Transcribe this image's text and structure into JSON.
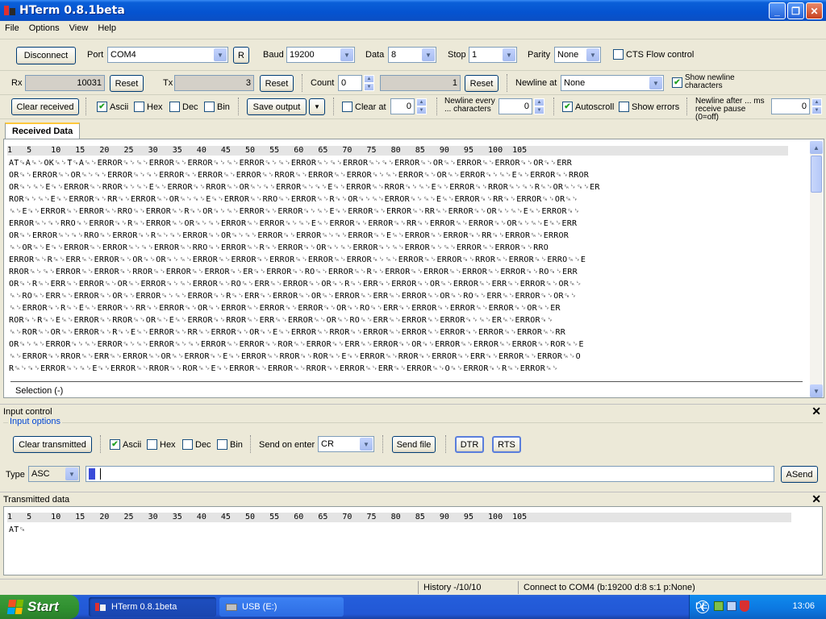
{
  "window": {
    "title": "HTerm 0.8.1beta"
  },
  "menu": [
    "File",
    "Options",
    "View",
    "Help"
  ],
  "connection": {
    "disconnect_label": "Disconnect",
    "port_label": "Port",
    "port_value": "COM4",
    "refresh_label": "R",
    "baud_label": "Baud",
    "baud_value": "19200",
    "data_label": "Data",
    "data_value": "8",
    "stop_label": "Stop",
    "stop_value": "1",
    "parity_label": "Parity",
    "parity_value": "None",
    "cts_label": "CTS Flow control",
    "cts_checked": false
  },
  "counters": {
    "rx_label": "Rx",
    "rx_value": "10031",
    "rx_reset": "Reset",
    "tx_label": "Tx",
    "tx_value": "3",
    "tx_reset": "Reset",
    "count_label": "Count",
    "count_value": "0",
    "count_total": "1",
    "count_reset": "Reset",
    "newline_label": "Newline at",
    "newline_value": "None",
    "show_newline_label": "Show newline characters"
  },
  "display": {
    "clear_received": "Clear received",
    "ascii": "Ascii",
    "hex": "Hex",
    "dec": "Dec",
    "bin": "Bin",
    "save_output": "Save output",
    "clear_at": "Clear at",
    "clear_at_value": "0",
    "newline_every": "Newline every ... characters",
    "newline_every_value": "0",
    "autoscroll": "Autoscroll",
    "show_errors": "Show errors",
    "newline_after": "Newline after ... ms receive pause (0=off)",
    "newline_after_value": "0"
  },
  "received": {
    "tab_label": "Received Data",
    "ruler": "1   5    10   15   20   25   30   35   40   45   50   55   60   65   70   75   80   85   90   95   100  105",
    "lines": [
      "AT␍A␍␊OK␍␊T␍A␍␊ERROR␍␊␍␊ERROR␍␊ERROR␍␊␍␊ERROR␍␊␍␊ERROR␍␊␍␊ERROR␍␊␍␊ERROR␍␊OR␍␊ERROR␍␊ERROR␍␊OR␍␊ERR",
      "OR␍␊ERROR␍␊OR␍␊␍␊ERROR␍␊␍␊ERROR␍␊ERROR␍␊ERROR␍␊RROR␍␊ERROR␍␊ERROR␍␊␍␊ERROR␍␊OR␍␊ERROR␍␊␍␊E␍␊ERROR␍␊RROR",
      "OR␍␊␍␊E␍␊ERROR␍␊RROR␍␊␍␊E␍␊ERROR␍␊RROR␍␊OR␍␊␍␊ERROR␍␊␍␊E␍␊ERROR␍␊RROR␍␊␍␊E␍␊ERROR␍␊RROR␍␊␍␊R␍␊OR␍␊␍␊ER",
      "ROR␍␊␍␊E␍␊ERROR␍␊RR␍␊ERROR␍␊OR␍␊␍␊E␍␊ERROR␍␊RRO␍␊ERROR␍␊R␍␊OR␍␊␍␊ERROR␍␊␍␊E␍␊ERROR␍␊RR␍␊ERROR␍␊OR␍␊",
      "␍␊E␍␊ERROR␍␊ERROR␍␊RRO␍␊ERROR␍␊R␍␊OR␍␊␍␊ERROR␍␊ERROR␍␊␍␊E␍␊ERROR␍␊ERROR␍␊RR␍␊ERROR␍␊OR␍␊␍␊E␍␊ERROR␍␊",
      "ERROR␍␊␍␊RRO␍␊ERROR␍␊R␍␊ERROR␍␊OR␍␊␍␊ERROR␍␊ERROR␍␊␍␊E␍␊ERROR␍␊ERROR␍␊RR␍␊ERROR␍␊ERROR␍␊OR␍␊␍␊E␍␊ERR",
      "OR␍␊ERROR␍␊␍␊RRO␍␊ERROR␍␊R␍␊␍␊ERROR␍␊OR␍␊␍␊ERROR␍␊ERROR␍␊␍␊ERROR␍␊E␍␊ERROR␍␊ERROR␍␊RR␍␊ERROR␍␊ERROR",
      "␍␊OR␍␊E␍␊ERROR␍␊ERROR␍␊␍␊ERROR␍␊RRO␍␊ERROR␍␊R␍␊ERROR␍␊OR␍␊␍␊ERROR␍␊␍␊ERROR␍␊␍␊ERROR␍␊ERROR␍␊RRO",
      "ERROR␍␊R␍␊ERR␍␊ERROR␍␊OR␍␊OR␍␊␍␊ERROR␍␊ERROR␍␊ERROR␍␊ERROR␍␊ERROR␍␊␍␊ERROR␍␊ERROR␍␊RROR␍␊ERROR␍␊ERRO␍␊E",
      "RROR␍␊␍␊ERROR␍␊ERROR␍␊RROR␍␊ERROR␍␊ERROR␍␊ER␍␊ERROR␍␊RO␍␊ERROR␍␊R␍␊ERROR␍␊ERROR␍␊ERROR␍␊ERROR␍␊RO␍␊ERR",
      "OR␍␊R␍␊ERR␍␊ERROR␍␊OR␍␊ERROR␍␊␍␊ERROR␍␊RO␍␊ERR␍␊ERROR␍␊OR␍␊R␍␊ERR␍␊ERROR␍␊OR␍␊ERROR␍␊ERR␍␊ERROR␍␊OR␍␊",
      "␍␊RO␍␊ERR␍␊ERROR␍␊OR␍␊ERROR␍␊␍␊ERROR␍␊R␍␊ERR␍␊ERROR␍␊OR␍␊ERROR␍␊ERR␍␊ERROR␍␊OR␍␊RO␍␊ERR␍␊ERROR␍␊OR␍␊",
      "␍␊ERROR␍␊R␍␊E␍␊ERROR␍␊RR␍␊ERROR␍␊OR␍␊ERROR␍␊ERROR␍␊ERROR␍␊OR␍␊RO␍␊ERR␍␊ERROR␍␊ERROR␍␊ERROR␍␊OR␍␊ER",
      "ROR␍␊R␍␊E␍␊ERROR␍␊RROR␍␊OR␍␊E␍␊ERROR␍␊RROR␍␊ERR␍␊ERROR␍␊OR␍␊RO␍␊ERR␍␊ERROR␍␊ERROR␍␊␍␊ER␍␊ERROR␍␊",
      "␍␊ROR␍␊OR␍␊ERROR␍␊R␍␊E␍␊ERROR␍␊RR␍␊ERROR␍␊OR␍␊E␍␊ERROR␍␊RROR␍␊ERROR␍␊ERROR␍␊ERROR␍␊ERROR␍␊ERROR␍␊RR",
      "OR␍␊␍␊ERROR␍␊␍␊ERROR␍␊␍␊ERROR␍␊␍␊ERROR␍␊ERROR␍␊ROR␍␊ERROR␍␊ERR␍␊ERROR␍␊OR␍␊ERROR␍␊ERROR␍␊ERROR␍␊ROR␍␊E",
      "␍␊ERROR␍␊RROR␍␊ERR␍␊ERROR␍␊OR␍␊ERROR␍␊E␍␊ERROR␍␊RROR␍␊ROR␍␊E␍␊ERROR␍␊RROR␍␊ERROR␍␊ERR␍␊ERROR␍␊ERROR␍␊O",
      "R␍␊␍␊ERROR␍␊␍␊E␍␊ERROR␍␊RROR␍␊ROR␍␊E␍␊ERROR␍␊ERROR␍␊RROR␍␊ERROR␍␊ERR␍␊ERROR␍␊O␍␊ERROR␍␊R␍␊ERROR␍␊"
    ],
    "selection_label": "Selection (-)"
  },
  "input": {
    "panel_title": "Input control",
    "group_title": "Input options",
    "clear_transmitted": "Clear transmitted",
    "ascii": "Ascii",
    "hex": "Hex",
    "dec": "Dec",
    "bin": "Bin",
    "send_on_enter_label": "Send on enter",
    "send_on_enter_value": "CR",
    "send_file": "Send file",
    "dtr": "DTR",
    "rts": "RTS",
    "type_label": "Type",
    "type_value": "ASC",
    "asend": "ASend"
  },
  "transmitted": {
    "panel_title": "Transmitted data",
    "ruler": "1   5    10   15   20   25   30   35   40   45   50   55   60   65   70   75   80   85   90   95   100  105",
    "lines": [
      "AT␍"
    ]
  },
  "status": {
    "history": "History -/10/10",
    "connection": "Connect to COM4 (b:19200 d:8 s:1 p:None)"
  },
  "taskbar": {
    "start": "Start",
    "items": [
      "HTerm 0.8.1beta",
      "USB (E:)"
    ],
    "lang": "DE",
    "clock": "13:06"
  }
}
